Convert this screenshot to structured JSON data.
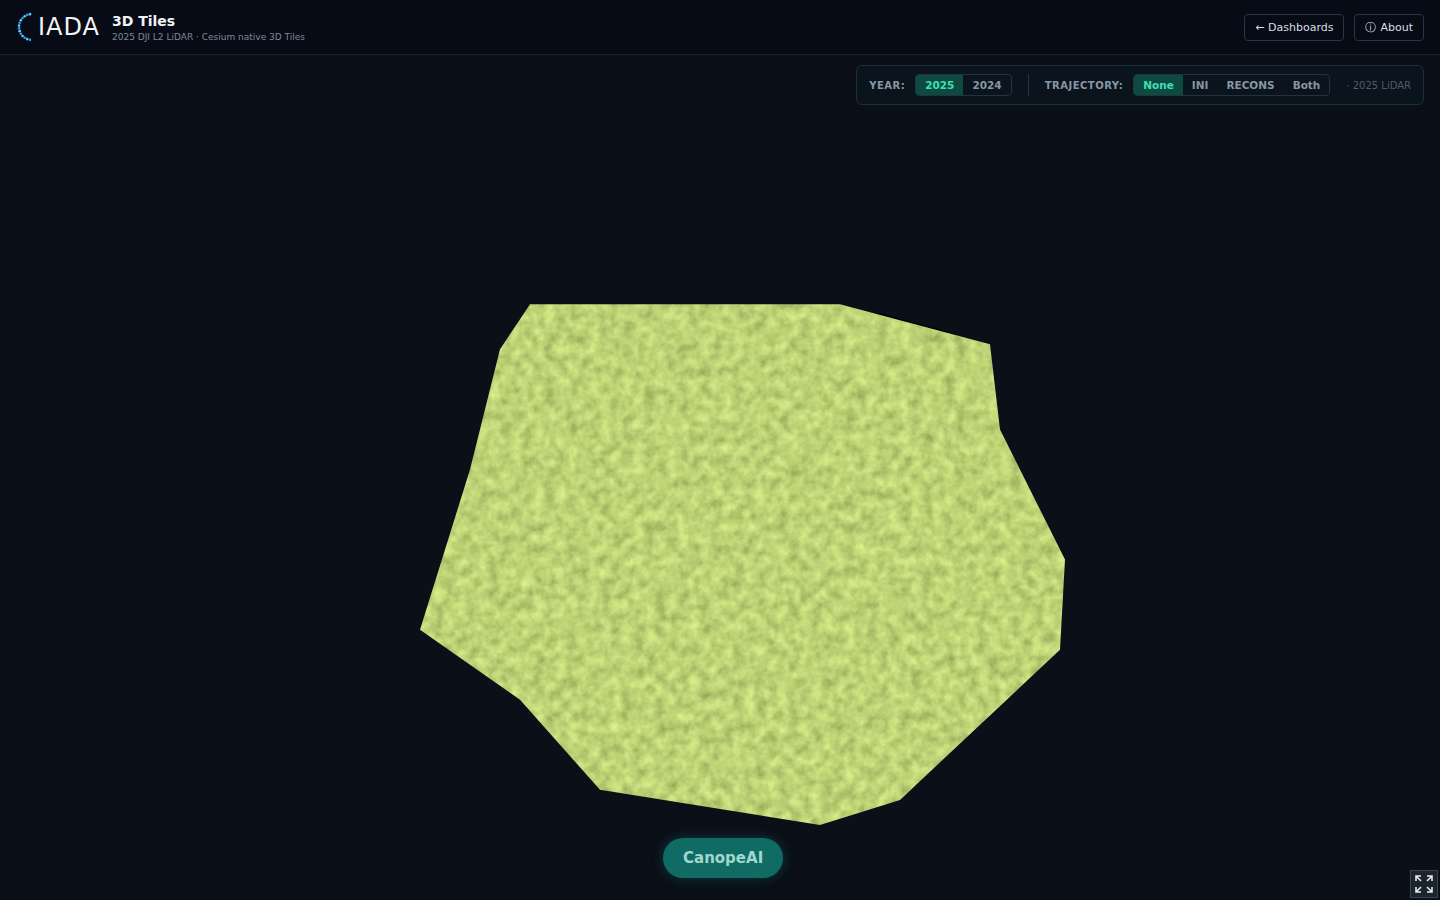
{
  "header": {
    "logo": "IADA",
    "title": "3D Tiles",
    "subtitle": "2025 DJI L2 LiDAR · Cesium native 3D Tiles",
    "buttons": [
      {
        "label": "← Dashboards",
        "icon": ""
      },
      {
        "label": "About",
        "icon": "ⓘ"
      }
    ]
  },
  "toolbar": {
    "groups": [
      {
        "label": "YEAR:",
        "options": [
          {
            "label": "2025",
            "selected": true
          },
          {
            "label": "2024",
            "selected": false
          }
        ]
      },
      {
        "label": "TRAJECTORY:",
        "options": [
          {
            "label": "None",
            "selected": true
          },
          {
            "label": "INI",
            "selected": false
          },
          {
            "label": "RECONS",
            "selected": false
          },
          {
            "label": "Both",
            "selected": false
          }
        ]
      }
    ],
    "note": "· 2025 LiDAR"
  },
  "viewer": {
    "canope_button": "CanopeAI"
  }
}
